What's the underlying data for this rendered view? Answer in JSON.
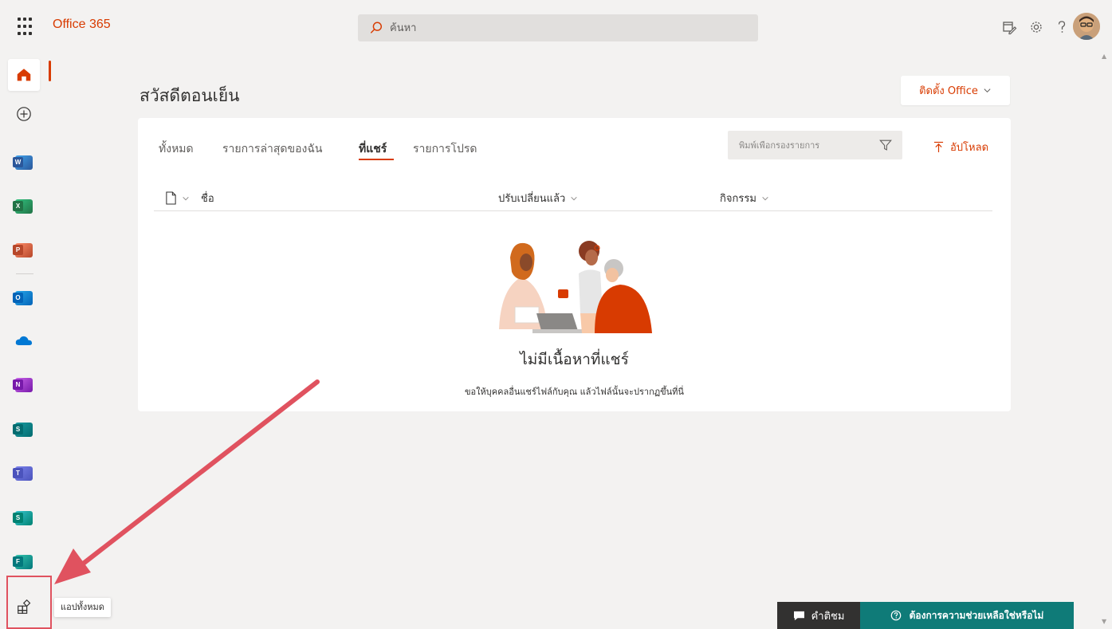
{
  "header": {
    "app_name": "Office 365",
    "search_placeholder": "ค้นหา"
  },
  "greeting": "สวัสดีตอนเย็น",
  "install_office": "ติดตั้ง Office",
  "tabs": [
    {
      "label": "ทั้งหมด"
    },
    {
      "label": "รายการล่าสุดของฉัน"
    },
    {
      "label": "ที่แชร์"
    },
    {
      "label": "รายการโปรด"
    }
  ],
  "filter_placeholder": "พิมพ์เพื่อกรองรายการ",
  "upload_label": "อัปโหลด",
  "columns": {
    "name": "ชื่อ",
    "modified": "ปรับเปลี่ยนแล้ว",
    "activity": "กิจกรรม"
  },
  "empty_state": {
    "title": "ไม่มีเนื้อหาที่แชร์",
    "subtitle": "ขอให้บุคคลอื่นแชร์ไฟล์กับคุณ แล้วไฟล์นั้นจะปรากฏขึ้นที่นี่"
  },
  "rail": {
    "all_apps_tooltip": "แอปทั้งหมด",
    "apps": [
      {
        "icon": "word-icon",
        "letter": "W",
        "color": "#2b579a",
        "accent": "#41a5ee"
      },
      {
        "icon": "excel-icon",
        "letter": "X",
        "color": "#217346",
        "accent": "#33c481"
      },
      {
        "icon": "powerpoint-icon",
        "letter": "P",
        "color": "#b7472a",
        "accent": "#ff8f6b"
      },
      {
        "icon": "outlook-icon",
        "letter": "O",
        "color": "#0364b8",
        "accent": "#28a8ea"
      },
      {
        "icon": "onedrive-icon",
        "letter": "",
        "color": "#0364b8",
        "accent": "#0078d4"
      },
      {
        "icon": "onenote-icon",
        "letter": "N",
        "color": "#7719aa",
        "accent": "#ca64ea"
      },
      {
        "icon": "sharepoint-icon",
        "letter": "S",
        "color": "#036c70",
        "accent": "#1a9ba1"
      },
      {
        "icon": "teams-icon",
        "letter": "T",
        "color": "#4b53bc",
        "accent": "#7b83eb"
      },
      {
        "icon": "sway-icon",
        "letter": "S",
        "color": "#008272",
        "accent": "#37c6d0"
      },
      {
        "icon": "forms-icon",
        "letter": "F",
        "color": "#03787c",
        "accent": "#35c6ae"
      }
    ]
  },
  "footer": {
    "feedback": "คำติชม",
    "help": "ต้องการความช่วยเหลือใช่หรือไม่"
  },
  "colors": {
    "brand": "#d83b01",
    "help_bg": "#0f7b78",
    "feedback_bg": "#323130",
    "annotation": "#e0525f"
  }
}
